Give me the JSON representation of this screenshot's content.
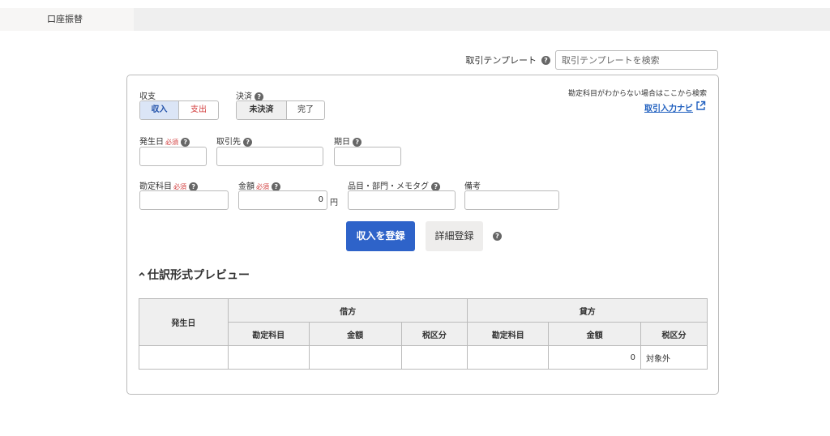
{
  "tab": {
    "label": "口座振替"
  },
  "template": {
    "label": "取引テンプレート",
    "placeholder": "取引テンプレートを検索"
  },
  "form": {
    "type_label": "収支",
    "type_income": "収入",
    "type_expense": "支出",
    "settle_label": "決済",
    "settle_unsettled": "未決済",
    "settle_done": "完了",
    "hint_text": "勘定科目がわからない場合はここから検索",
    "navi_link": "取引入力ナビ",
    "date_label": "発生日",
    "required": "必須",
    "partner_label": "取引先",
    "due_label": "期日",
    "account_label": "勘定科目",
    "amount_label": "金額",
    "amount_value": "0",
    "amount_unit": "円",
    "items_label": "品目・部門・メモタグ",
    "note_label": "備考",
    "submit_button": "収入を登録",
    "detail_button": "詳細登録"
  },
  "preview": {
    "title": "仕訳形式プレビュー",
    "col_date": "発生日",
    "debit": "借方",
    "credit": "貸方",
    "sub_account": "勘定科目",
    "sub_amount": "金額",
    "sub_tax": "税区分",
    "row": {
      "credit_amount": "0",
      "credit_tax": "対象外"
    }
  },
  "colors": {
    "primary": "#2e63c9",
    "required": "#d23c3c",
    "link": "#1f5fbf"
  }
}
